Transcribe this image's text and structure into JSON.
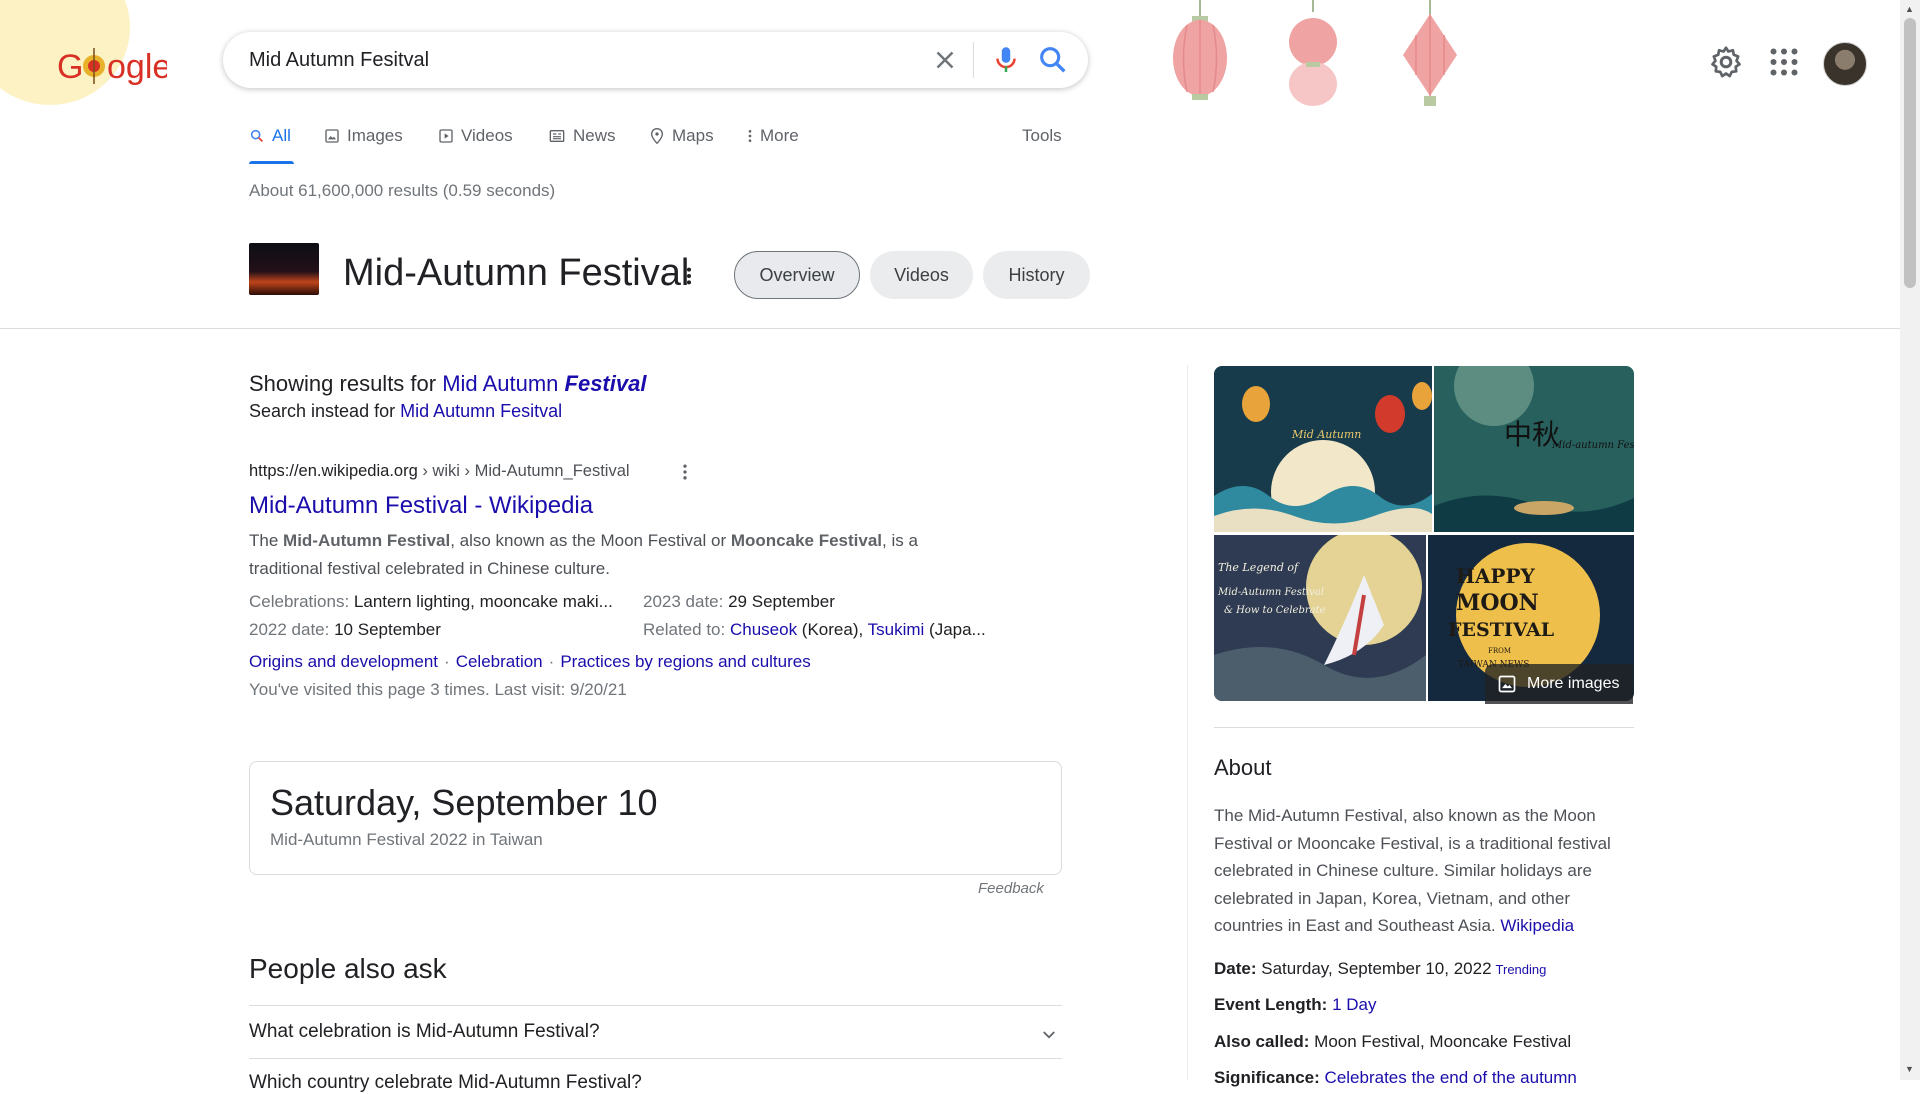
{
  "header": {
    "logo_text": "Google",
    "search_value": "Mid Autumn Fesitval"
  },
  "tabs": [
    {
      "label": "All",
      "icon": "search-icon",
      "active": true
    },
    {
      "label": "Images",
      "icon": "image-icon"
    },
    {
      "label": "Videos",
      "icon": "video-icon"
    },
    {
      "label": "News",
      "icon": "newspaper-icon"
    },
    {
      "label": "Maps",
      "icon": "map-pin-icon"
    },
    {
      "label": "More",
      "icon": "vertical-dots-icon"
    }
  ],
  "tools_label": "Tools",
  "result_stats": "About 61,600,000 results (0.59 seconds)",
  "entity": {
    "title": "Mid-Autumn Festival",
    "chips": [
      "Overview",
      "Videos",
      "History"
    ],
    "selected_chip": "Overview"
  },
  "spelling": {
    "showing_prefix": "Showing results for",
    "corrected_plain": "Mid Autumn",
    "corrected_bold": "Festival",
    "instead_prefix": "Search instead for",
    "original_query": "Mid Autumn Fesitval"
  },
  "result": {
    "url": "https://en.wikipedia.org",
    "breadcrumb": " › wiki › Mid-Autumn_Festival",
    "title": "Mid-Autumn Festival - Wikipedia",
    "snippet_parts": {
      "p1": "The ",
      "b1": "Mid-Autumn Festival",
      "p2": ", also known as the Moon Festival or ",
      "b2": "Mooncake Festival",
      "p3": ", is a traditional festival celebrated in Chinese culture."
    },
    "facts": {
      "celebrations_label": "Celebrations:",
      "celebrations_value": "Lantern lighting, mooncake maki...",
      "date2022_label": "2022 date:",
      "date2022_value": "10 September",
      "date2023_label": "2023 date:",
      "date2023_value": "29 September",
      "related_label": "Related to:",
      "related_link1": "Chuseok",
      "related_mid": " (Korea), ",
      "related_link2": "Tsukimi",
      "related_tail": " (Japa..."
    },
    "sitelinks": [
      "Origins and development",
      "Celebration",
      "Practices by regions and cultures"
    ],
    "visited": "You've visited this page 3 times. Last visit: 9/20/21"
  },
  "date_card": {
    "main": "Saturday, September 10",
    "sub": "Mid-Autumn Festival 2022 in Taiwan"
  },
  "feedback": "Feedback",
  "people_also_ask": {
    "title": "People also ask",
    "questions": [
      "What celebration is Mid-Autumn Festival?",
      "Which country celebrate Mid-Autumn Festival?"
    ]
  },
  "knowledge_panel": {
    "image_texts": {
      "tile1": "Mid Autumn",
      "tile2a": "中秋",
      "tile2b": "Mid-autumn Festival",
      "tile3a": "The Legend of",
      "tile3b": "Mid-Autumn Festival",
      "tile3c": "& How to Celebrate",
      "tile4a": "HAPPY",
      "tile4b": "MOON",
      "tile4c": "FESTIVAL",
      "tile4d": "FROM",
      "tile4e": "TAIWAN NEWS"
    },
    "more_images": "More images",
    "about_title": "About",
    "about_text": "The Mid-Autumn Festival, also known as the Moon Festival or Mooncake Festival, is a traditional festival celebrated in Chinese culture. Similar holidays are celebrated in Japan, Korea, Vietnam, and other countries in East and Southeast Asia.",
    "about_source": "Wikipedia",
    "date_label": "Date:",
    "date_value": "Saturday, September 10, 2022",
    "trending": "Trending",
    "length_label": "Event Length:",
    "length_value": "1 Day",
    "also_label": "Also called:",
    "also_value": "Moon Festival, Mooncake Festival",
    "significance_label": "Significance:",
    "significance_value": "Celebrates the end of the autumn"
  },
  "colors": {
    "link": "#1a0dab",
    "accent": "#1a73e8",
    "muted": "#70757a"
  }
}
